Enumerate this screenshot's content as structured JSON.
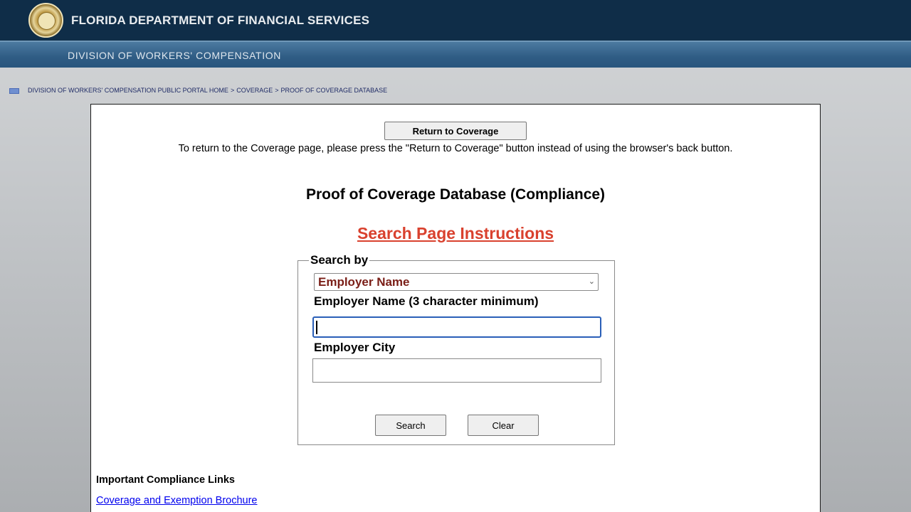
{
  "header": {
    "agency_title": "FLORIDA DEPARTMENT OF FINANCIAL SERVICES",
    "division_title": "DIVISION OF WORKERS' COMPENSATION"
  },
  "breadcrumb": {
    "items": [
      "DIVISION OF WORKERS' COMPENSATION PUBLIC PORTAL HOME",
      "COVERAGE",
      "PROOF OF COVERAGE DATABASE"
    ],
    "separator": ">"
  },
  "main": {
    "return_button_label": "Return to Coverage",
    "return_note": "To return to the Coverage page, please press the \"Return to Coverage\" button instead of using the browser's back button.",
    "page_title": "Proof of Coverage Database (Compliance)",
    "instructions_link": "Search Page Instructions",
    "search_form": {
      "legend": "Search by",
      "search_by_selected": "Employer Name",
      "employer_name_label": "Employer Name (3 character minimum)",
      "employer_name_value": "",
      "employer_city_label": "Employer City",
      "employer_city_value": "",
      "search_button": "Search",
      "clear_button": "Clear"
    },
    "links_heading": "Important Compliance Links",
    "links": [
      "Coverage and Exemption Brochure"
    ]
  },
  "colors": {
    "header_dark": "#0f2d48",
    "header_blue": "#2f5c84",
    "instructions_red": "#d9412e",
    "select_text": "#7a1e17",
    "link_blue": "#0000ee",
    "focus_blue": "#2a5fb8"
  }
}
